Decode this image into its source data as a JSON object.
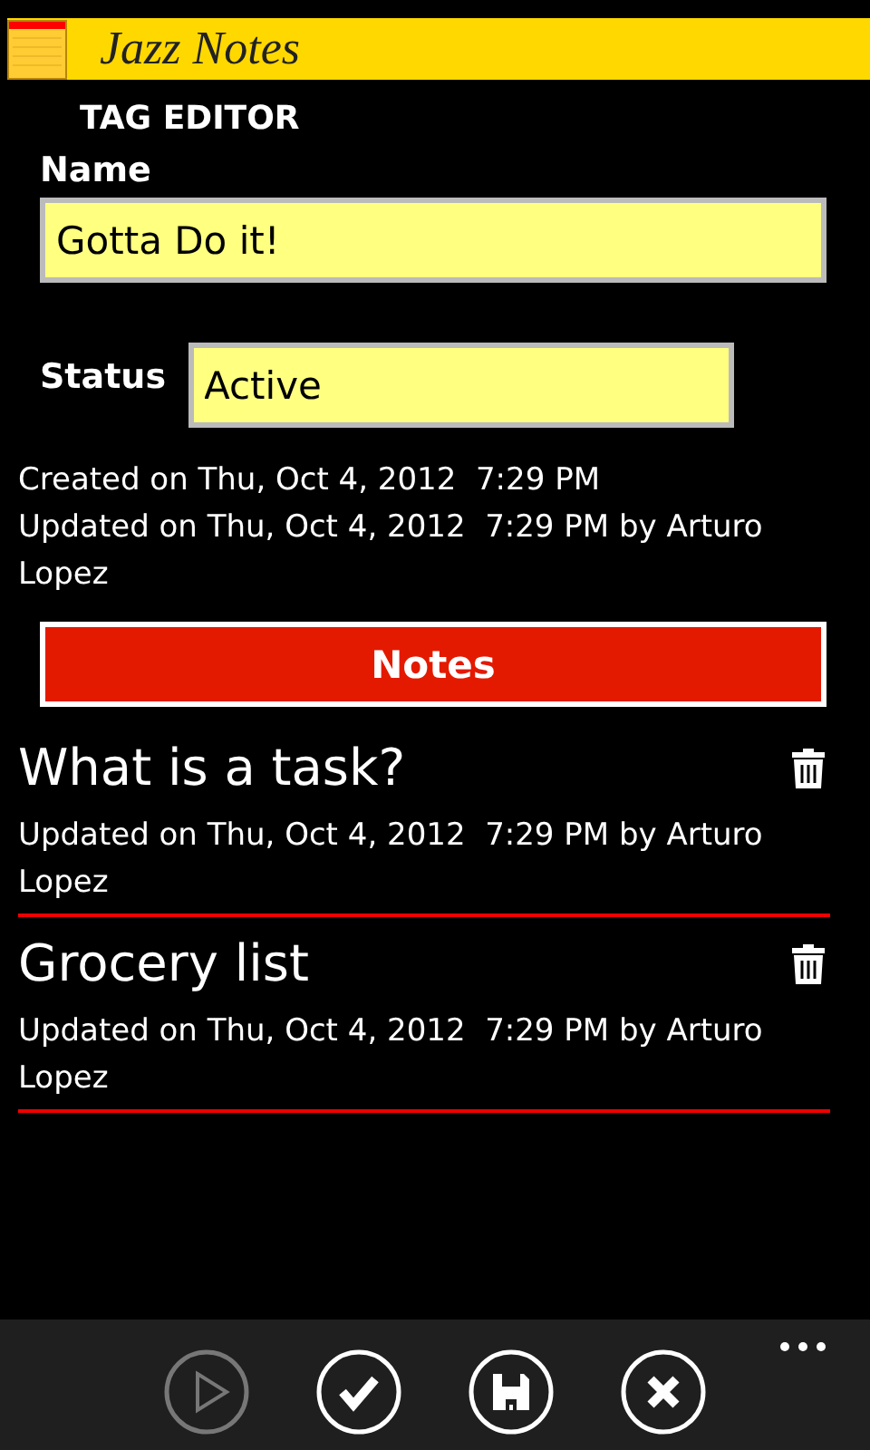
{
  "header": {
    "title": "Jazz Notes"
  },
  "page_title": "TAG EDITOR",
  "name_field": {
    "label": "Name",
    "value": "Gotta Do it!"
  },
  "status_field": {
    "label": "Status",
    "value": "Active"
  },
  "created": "Created on Thu, Oct 4, 2012  7:29 PM",
  "updated": "Updated on Thu, Oct 4, 2012  7:29 PM by Arturo Lopez",
  "notes_button": "Notes",
  "notes": [
    {
      "title": "What is a task?",
      "updated": "Updated on Thu, Oct 4, 2012  7:29 PM by Arturo Lopez"
    },
    {
      "title": "Grocery list",
      "updated": "Updated on Thu, Oct 4, 2012  7:29 PM by Arturo Lopez"
    }
  ],
  "app_bar": [
    {
      "kind": "play",
      "disabled": true
    },
    {
      "kind": "check",
      "disabled": false
    },
    {
      "kind": "save",
      "disabled": false
    },
    {
      "kind": "close",
      "disabled": false
    }
  ]
}
